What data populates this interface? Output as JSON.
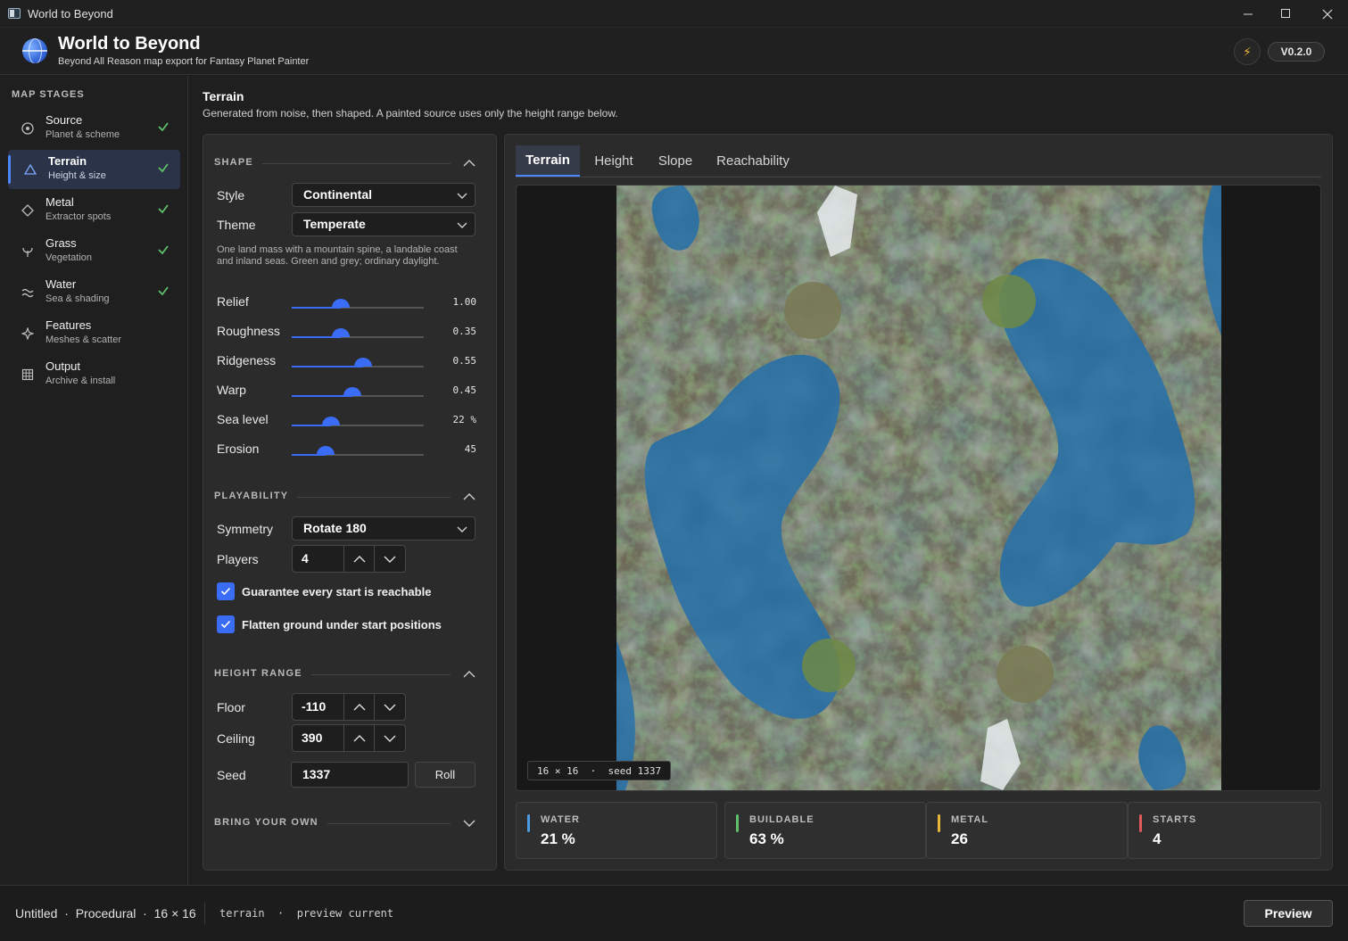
{
  "window": {
    "title": "World to Beyond"
  },
  "header": {
    "title": "World to Beyond",
    "subtitle": "Beyond All Reason map export for Fantasy Planet Painter",
    "version": "V0.2.0",
    "accent": "#4b86ff"
  },
  "sidebar": {
    "heading": "MAP STAGES",
    "items": [
      {
        "label": "Source",
        "desc": "Planet & scheme",
        "icon": "target-icon",
        "done": true
      },
      {
        "label": "Terrain",
        "desc": "Height & size",
        "icon": "triangle-icon",
        "done": true,
        "active": true
      },
      {
        "label": "Metal",
        "desc": "Extractor spots",
        "icon": "diamond-icon",
        "done": true
      },
      {
        "label": "Grass",
        "desc": "Vegetation",
        "icon": "sprout-icon",
        "done": true
      },
      {
        "label": "Water",
        "desc": "Sea & shading",
        "icon": "waves-icon",
        "done": true
      },
      {
        "label": "Features",
        "desc": "Meshes & scatter",
        "icon": "sparkle-icon",
        "done": false
      },
      {
        "label": "Output",
        "desc": "Archive & install",
        "icon": "grid-icon",
        "done": false
      }
    ]
  },
  "page": {
    "title": "Terrain",
    "subtitle": "Generated from noise, then shaped. A painted source uses only the height range below."
  },
  "shape": {
    "heading": "SHAPE",
    "style_label": "Style",
    "style_value": "Continental",
    "theme_label": "Theme",
    "theme_value": "Temperate",
    "description": "One land mass with a mountain spine, a landable coast and inland seas. Green and grey; ordinary daylight.",
    "sliders": [
      {
        "label": "Relief",
        "display": "1.00",
        "level": 0.37
      },
      {
        "label": "Roughness",
        "display": "0.35",
        "level": 0.37
      },
      {
        "label": "Ridgeness",
        "display": "0.55",
        "level": 0.54
      },
      {
        "label": "Warp",
        "display": "0.45",
        "level": 0.46
      },
      {
        "label": "Sea level",
        "display": "22 %",
        "level": 0.3
      },
      {
        "label": "Erosion",
        "display": "45",
        "level": 0.26
      }
    ]
  },
  "playability": {
    "heading": "PLAYABILITY",
    "symmetry_label": "Symmetry",
    "symmetry_value": "Rotate 180",
    "players_label": "Players",
    "players_value": "4",
    "check_reachable": "Guarantee every start is reachable",
    "check_flatten": "Flatten ground under start positions"
  },
  "height_range": {
    "heading": "HEIGHT RANGE",
    "floor_label": "Floor",
    "floor_value": "-110",
    "ceiling_label": "Ceiling",
    "ceiling_value": "390",
    "seed_label": "Seed",
    "seed_value": "1337",
    "roll_label": "Roll"
  },
  "byo": {
    "heading": "BRING YOUR OWN"
  },
  "tabs": [
    "Terrain",
    "Height",
    "Slope",
    "Reachability"
  ],
  "map": {
    "label": "16 × 16  ·  seed 1337"
  },
  "stats": [
    {
      "label": "WATER",
      "value": "21 %",
      "color": "#4a9be0"
    },
    {
      "label": "BUILDABLE",
      "value": "63 %",
      "color": "#5fbf6a"
    },
    {
      "label": "METAL",
      "value": "26",
      "color": "#e8b83a"
    },
    {
      "label": "STARTS",
      "value": "4",
      "color": "#e05a5a"
    }
  ],
  "status": {
    "text": "Untitled  ·  Procedural  ·  16 × 16",
    "mono": "terrain  ·  preview current",
    "preview_button": "Preview"
  }
}
